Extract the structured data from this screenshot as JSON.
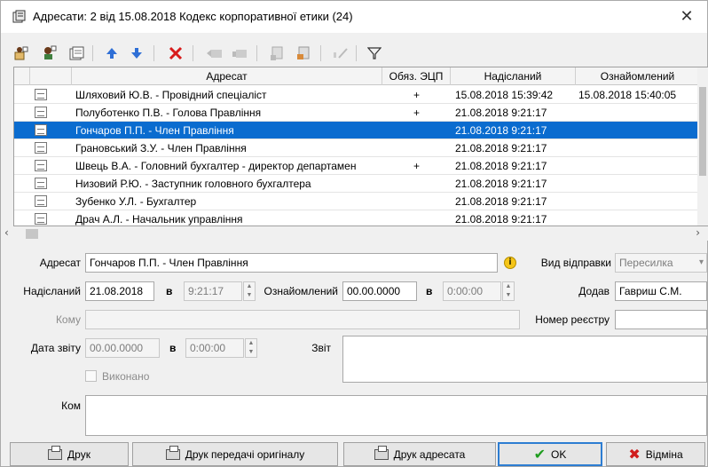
{
  "window": {
    "title": "Адресати: 2 від 15.08.2018 Кодекс корпоративної етики (24)",
    "close_glyph": "✕"
  },
  "toolbar": {
    "icons": [
      "add-addressee-icon",
      "add-group-icon",
      "add-list-icon",
      "move-up-icon",
      "move-down-icon",
      "delete-icon",
      "send-icon",
      "send-all-icon",
      "sign-icon",
      "document-icon",
      "approve-icon",
      "filter-icon"
    ]
  },
  "grid": {
    "columns": [
      "",
      "Адресат",
      "Обяз. ЭЦП",
      "Надісланий",
      "Ознайомлений"
    ],
    "rows": [
      {
        "addressee": "Шляховий Ю.В. - Провідний спеціаліст",
        "ecp": "+",
        "sent": "15.08.2018 15:39:42",
        "read": "15.08.2018 15:40:05",
        "selected": false
      },
      {
        "addressee": "Полуботенко П.В. - Голова Правління",
        "ecp": "+",
        "sent": "21.08.2018 9:21:17",
        "read": "",
        "selected": false
      },
      {
        "addressee": "Гончаров П.П. - Член Правління",
        "ecp": "",
        "sent": "21.08.2018 9:21:17",
        "read": "",
        "selected": true
      },
      {
        "addressee": "Грановський З.У. - Член Правління",
        "ecp": "",
        "sent": "21.08.2018 9:21:17",
        "read": "",
        "selected": false
      },
      {
        "addressee": "Швець В.А. - Головний бухгалтер - директор департамен",
        "ecp": "+",
        "sent": "21.08.2018 9:21:17",
        "read": "",
        "selected": false
      },
      {
        "addressee": "Низовий Р.Ю. - Заступник головного бухгалтера",
        "ecp": "",
        "sent": "21.08.2018 9:21:17",
        "read": "",
        "selected": false
      },
      {
        "addressee": "Зубенко У.Л. - Бухгалтер",
        "ecp": "",
        "sent": "21.08.2018 9:21:17",
        "read": "",
        "selected": false
      },
      {
        "addressee": "Драч А.Л. - Начальник управління",
        "ecp": "",
        "sent": "21.08.2018 9:21:17",
        "read": "",
        "selected": false
      }
    ]
  },
  "form": {
    "addressee_label": "Адресат",
    "addressee_value": "Гончаров П.П. - Член Правління",
    "send_type_label": "Вид відправки",
    "send_type_value": "Пересилка",
    "sent_label": "Надісланий",
    "sent_date": "21.08.2018",
    "sent_in": "в",
    "sent_time": "9:21:17",
    "read_label": "Ознайомлений",
    "read_date": "00.00.0000",
    "read_in": "в",
    "read_time": "0:00:00",
    "added_label": "Додав",
    "added_value": "Гавриш С.М.",
    "to_label": "Кому",
    "to_value": "",
    "registry_label": "Номер реєстру",
    "registry_value": "",
    "report_date_label": "Дата звіту",
    "report_date": "00.00.0000",
    "report_in": "в",
    "report_time": "0:00:00",
    "report_label": "Звіт",
    "report_value": "",
    "done_label": "Виконано",
    "comment_label": "Ком",
    "comment_value": ""
  },
  "buttons": {
    "print": "Друк",
    "print_transfer": "Друк передачі оригіналу",
    "print_addressee": "Друк адресата",
    "ok": "OK",
    "cancel": "Відміна"
  },
  "colors": {
    "selection": "#0a6ccf",
    "ok_check": "#1f9d1f",
    "cancel_x": "#d01c1c",
    "delete_red": "#d81b1b",
    "arrow_blue": "#2f6fd6"
  }
}
